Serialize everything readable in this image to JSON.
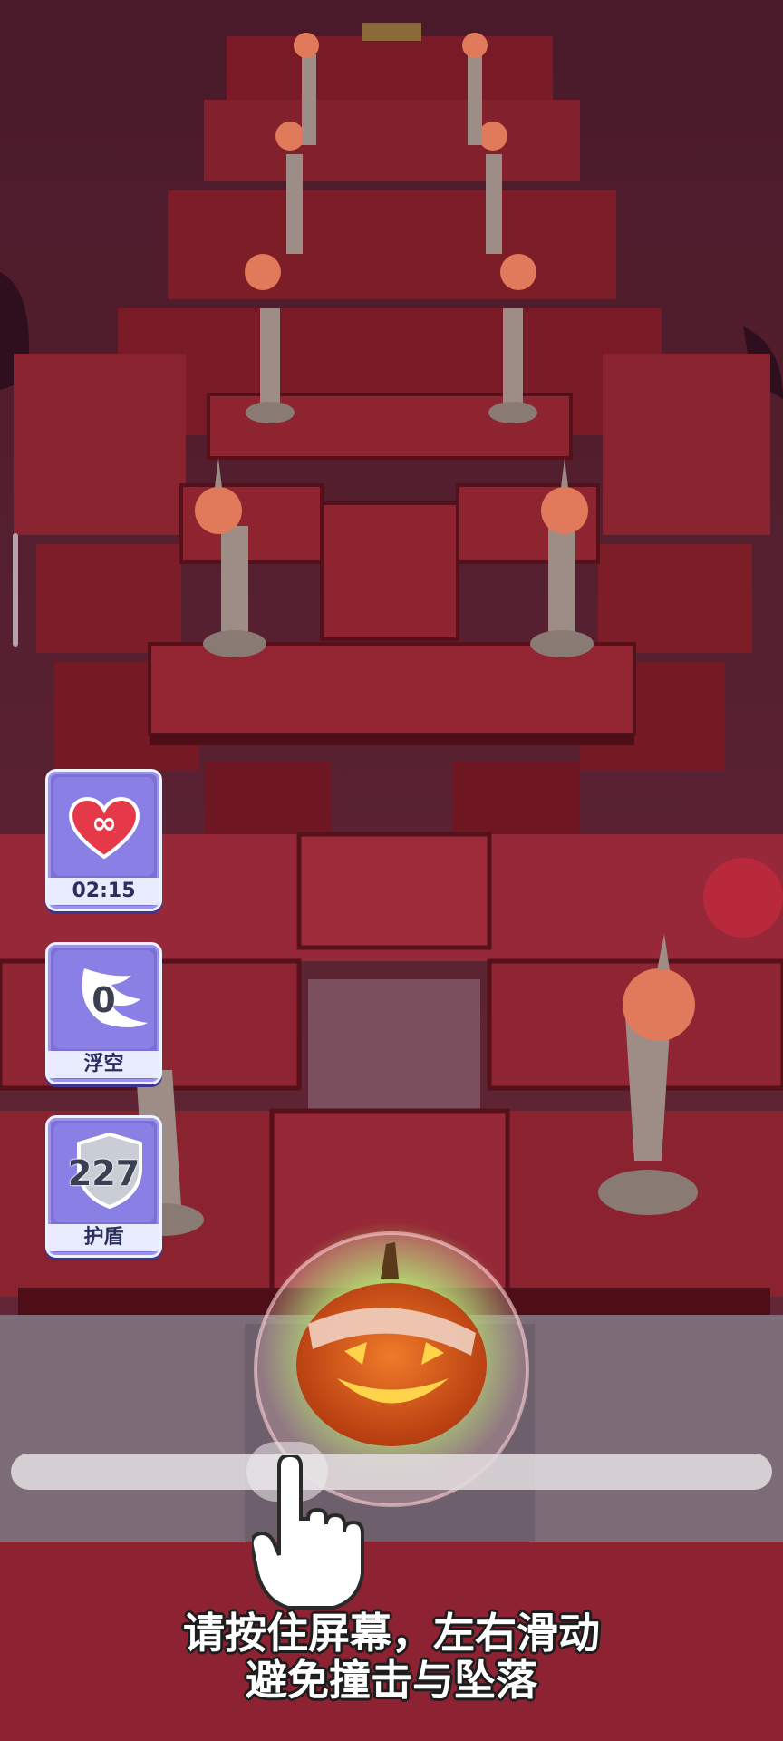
{
  "colors": {
    "sky": "#5a1f2e",
    "tile": "#8a1f2a",
    "tile_shadow": "#5c1019",
    "card_bg": "#7c6fd6",
    "glow": "#7bd43c",
    "pumpkin": "#e2631f"
  },
  "powerups": [
    {
      "icon": "infinity-heart-icon",
      "value": "∞",
      "label": "02:15"
    },
    {
      "icon": "wing-icon",
      "value": "0",
      "label": "浮空"
    },
    {
      "icon": "shield-icon",
      "value": "227",
      "label": "护盾"
    }
  ],
  "slider_fill": 0.37,
  "instruction": {
    "line1": "请按住屏幕，左右滑动",
    "line2": "避免撞击与坠落"
  }
}
